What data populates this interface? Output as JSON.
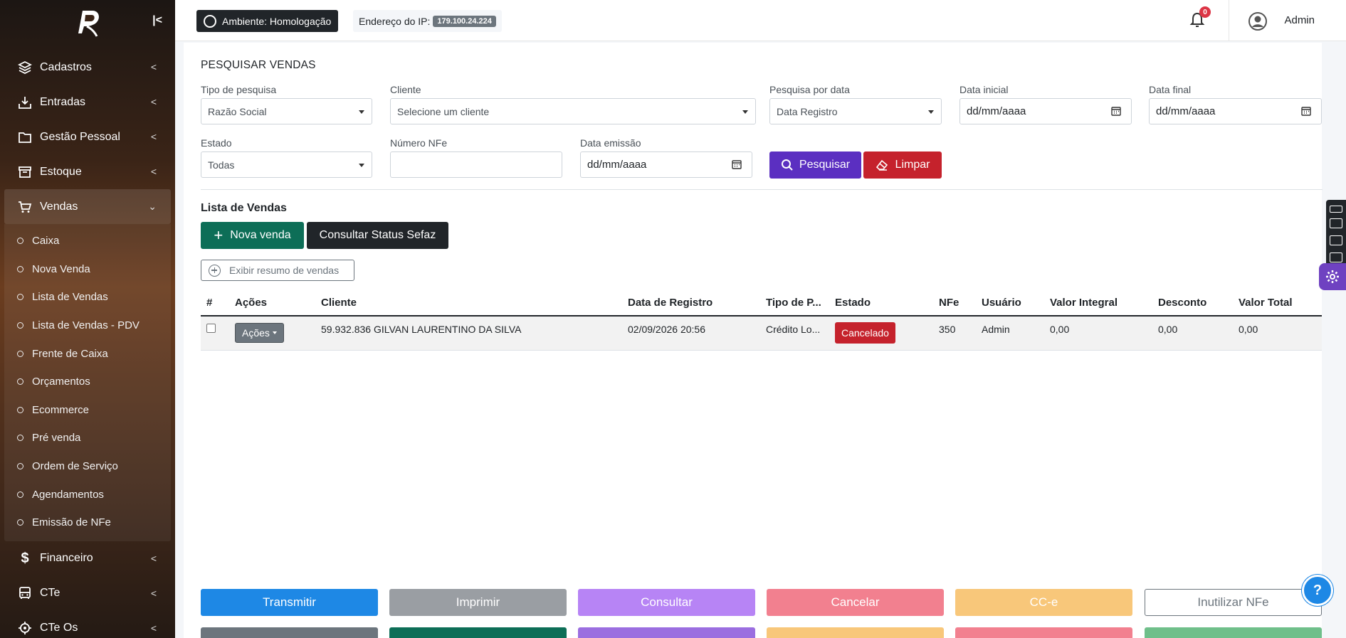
{
  "sidebar": {
    "items": [
      {
        "label": "Cadastros",
        "icon": "layers-icon"
      },
      {
        "label": "Entradas",
        "icon": "download-icon"
      },
      {
        "label": "Gestão Pessoal",
        "icon": "folder-icon"
      },
      {
        "label": "Estoque",
        "icon": "archive-icon"
      },
      {
        "label": "Vendas",
        "icon": "cart-icon"
      },
      {
        "label": "Financeiro",
        "icon": "dollar-icon"
      },
      {
        "label": "CTe",
        "icon": "bus-icon"
      },
      {
        "label": "CTe Os",
        "icon": "target-icon"
      }
    ],
    "vendas_sub": [
      "Caixa",
      "Nova Venda",
      "Lista de Vendas",
      "Lista de Vendas - PDV",
      "Frente de Caixa",
      "Orçamentos",
      "Ecommerce",
      "Pré venda",
      "Ordem de Serviço",
      "Agendamentos",
      "Emissão de NFe"
    ]
  },
  "topbar": {
    "env_label": "Ambiente: Homologação",
    "ip_label": "Endereço do IP:",
    "ip_value": "179.100.24.224",
    "notif_count": "0",
    "user": "Admin"
  },
  "filters": {
    "title": "PESQUISAR VENDAS",
    "tipo_label": "Tipo de pesquisa",
    "tipo_value": "Razão Social",
    "cliente_label": "Cliente",
    "cliente_placeholder": "Selecione um cliente",
    "pesquisa_data_label": "Pesquisa por data",
    "pesquisa_data_value": "Data Registro",
    "data_inicial_label": "Data inicial",
    "data_inicial_value": "dd/mm/aaaa",
    "data_final_label": "Data final",
    "data_final_value": "dd/mm/aaaa",
    "estado_label": "Estado",
    "estado_value": "Todas",
    "numero_nfe_label": "Número NFe",
    "numero_nfe_value": "",
    "data_emissao_label": "Data emissão",
    "data_emissao_value": "dd/mm/aaaa",
    "pesquisar": "Pesquisar",
    "limpar": "Limpar"
  },
  "list": {
    "title": "Lista de Vendas",
    "nova_venda": "Nova venda",
    "consultar_status": "Consultar Status Sefaz",
    "exibir_resumo": "Exibir resumo de vendas",
    "columns": [
      "#",
      "Ações",
      "Cliente",
      "Data de Registro",
      "Tipo de P...",
      "Estado",
      "NFe",
      "Usuário",
      "Valor Integral",
      "Desconto",
      "Valor Total"
    ],
    "rows": [
      {
        "acoes": "Ações",
        "cliente": "59.932.836 GILVAN LAURENTINO DA SILVA",
        "data": "02/09/2026 20:56",
        "tipo": "Crédito Lo...",
        "estado": "Cancelado",
        "nfe": "350",
        "usuario": "Admin",
        "valor_integral": "0,00",
        "desconto": "0,00",
        "valor_total": "0,00"
      }
    ]
  },
  "actions": {
    "transmitir": "Transmitir",
    "imprimir": "Imprimir",
    "consultar": "Consultar",
    "cancelar": "Cancelar",
    "cce": "CC-e",
    "inutilizar": "Inutilizar NFe",
    "colors": {
      "transmitir": "#1e88e5",
      "imprimir": "#9a9ea3",
      "consultar": "#b784f5",
      "cancelar": "#f2808f",
      "cce": "#f8c77a"
    }
  },
  "colors": {
    "accent_purple": "#5b2fc1",
    "danger": "#c5222c",
    "success": "#0d6e57"
  }
}
